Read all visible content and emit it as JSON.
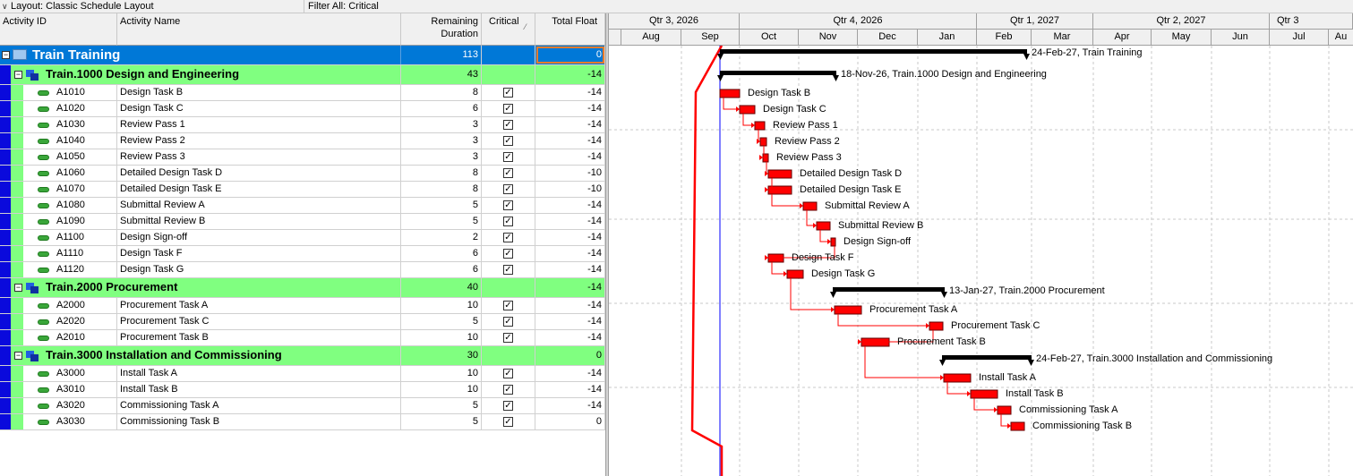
{
  "toolbar": {
    "layout_label": "Layout: Classic Schedule Layout",
    "filter_label": "Filter All: Critical"
  },
  "columns": {
    "activity_id": "Activity ID",
    "activity_name": "Activity Name",
    "remaining_duration_1": "Remaining",
    "remaining_duration_2": "Duration",
    "critical": "Critical",
    "total_float": "Total Float"
  },
  "colors": {
    "project_row": "#0078d7",
    "wbs_row": "#80ff80",
    "bar": "#ff0000",
    "summary_bar": "#000000",
    "data_date": "#0000ff"
  },
  "rows": [
    {
      "type": "project",
      "name": "Train  Training",
      "duration": "113",
      "float": "0"
    },
    {
      "type": "wbs",
      "name": "Train.1000  Design and Engineering",
      "duration": "43",
      "float": "-14"
    },
    {
      "type": "activity",
      "id": "A1010",
      "name": "Design Task B",
      "duration": "8",
      "critical": true,
      "float": "-14"
    },
    {
      "type": "activity",
      "id": "A1020",
      "name": "Design Task C",
      "duration": "6",
      "critical": true,
      "float": "-14"
    },
    {
      "type": "activity",
      "id": "A1030",
      "name": "Review Pass 1",
      "duration": "3",
      "critical": true,
      "float": "-14"
    },
    {
      "type": "activity",
      "id": "A1040",
      "name": "Review Pass 2",
      "duration": "3",
      "critical": true,
      "float": "-14"
    },
    {
      "type": "activity",
      "id": "A1050",
      "name": "Review Pass 3",
      "duration": "3",
      "critical": true,
      "float": "-14"
    },
    {
      "type": "activity",
      "id": "A1060",
      "name": "Detailed Design Task D",
      "duration": "8",
      "critical": true,
      "float": "-10"
    },
    {
      "type": "activity",
      "id": "A1070",
      "name": "Detailed Design Task E",
      "duration": "8",
      "critical": true,
      "float": "-10"
    },
    {
      "type": "activity",
      "id": "A1080",
      "name": "Submittal Review A",
      "duration": "5",
      "critical": true,
      "float": "-14"
    },
    {
      "type": "activity",
      "id": "A1090",
      "name": "Submittal Review B",
      "duration": "5",
      "critical": true,
      "float": "-14"
    },
    {
      "type": "activity",
      "id": "A1100",
      "name": "Design Sign-off",
      "duration": "2",
      "critical": true,
      "float": "-14"
    },
    {
      "type": "activity",
      "id": "A1110",
      "name": "Design Task F",
      "duration": "6",
      "critical": true,
      "float": "-14"
    },
    {
      "type": "activity",
      "id": "A1120",
      "name": "Design Task G",
      "duration": "6",
      "critical": true,
      "float": "-14"
    },
    {
      "type": "wbs",
      "name": "Train.2000  Procurement",
      "duration": "40",
      "float": "-14"
    },
    {
      "type": "activity",
      "id": "A2000",
      "name": "Procurement Task A",
      "duration": "10",
      "critical": true,
      "float": "-14"
    },
    {
      "type": "activity",
      "id": "A2020",
      "name": "Procurement Task C",
      "duration": "5",
      "critical": true,
      "float": "-14"
    },
    {
      "type": "activity",
      "id": "A2010",
      "name": "Procurement Task B",
      "duration": "10",
      "critical": true,
      "float": "-14"
    },
    {
      "type": "wbs",
      "name": "Train.3000  Installation and Commissioning",
      "duration": "30",
      "float": "0"
    },
    {
      "type": "activity",
      "id": "A3000",
      "name": "Install Task A",
      "duration": "10",
      "critical": true,
      "float": "-14"
    },
    {
      "type": "activity",
      "id": "A3010",
      "name": "Install Task B",
      "duration": "10",
      "critical": true,
      "float": "-14"
    },
    {
      "type": "activity",
      "id": "A3020",
      "name": "Commissioning Task A",
      "duration": "5",
      "critical": true,
      "float": "-14"
    },
    {
      "type": "activity",
      "id": "A3030",
      "name": "Commissioning Task B",
      "duration": "5",
      "critical": true,
      "float": "0"
    }
  ],
  "timescale": {
    "quarters": [
      "Qtr 3, 2026",
      "Qtr 4, 2026",
      "Qtr 1, 2027",
      "Qtr 2, 2027",
      "Qtr 3"
    ],
    "months": [
      "Aug",
      "Sep",
      "Oct",
      "Nov",
      "Dec",
      "Jan",
      "Feb",
      "Mar",
      "Apr",
      "May",
      "Jun",
      "Jul",
      "Au"
    ]
  },
  "gantt_labels": [
    "24-Feb-27, Train  Training",
    "18-Nov-26, Train.1000  Design and Engineering",
    "13-Jan-27, Train.2000  Procurement",
    "24-Feb-27, Train.3000  Installation and Commissioning"
  ]
}
